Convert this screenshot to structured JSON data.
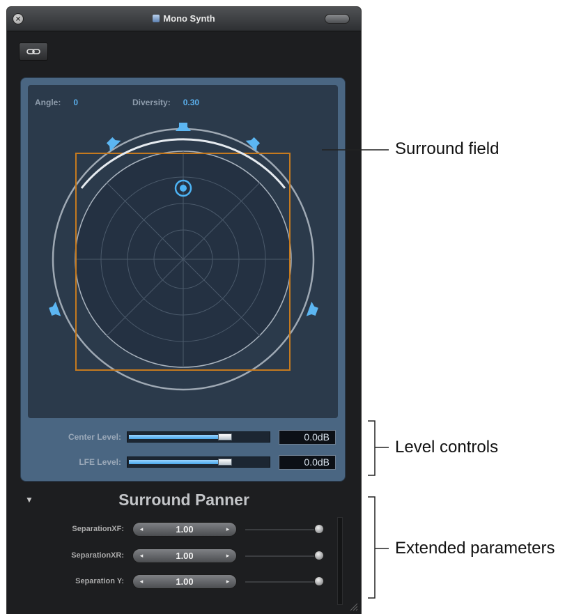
{
  "window": {
    "title": "Mono Synth",
    "close_symbol": "×"
  },
  "toolbar": {
    "link_icon": "link-icon"
  },
  "surround_field": {
    "angle_label": "Angle:",
    "angle_value": "0",
    "diversity_label": "Diversity:",
    "diversity_value": "0.30",
    "speaker_icon": "speaker-icon",
    "accent_color": "#4db4f5",
    "square_color": "#c57a1f"
  },
  "levels": {
    "center": {
      "label": "Center Level:",
      "value": "0.0dB",
      "fill_percent": 66
    },
    "lfe": {
      "label": "LFE Level:",
      "value": "0.0dB",
      "fill_percent": 66
    }
  },
  "extended": {
    "title": "Surround Panner",
    "disclosure_symbol": "▼",
    "params": [
      {
        "label": "SeparationXF:",
        "value": "1.00",
        "slider_percent": 100
      },
      {
        "label": "SeparationXR:",
        "value": "1.00",
        "slider_percent": 100
      },
      {
        "label": "Separation Y:",
        "value": "1.00",
        "slider_percent": 100
      }
    ]
  },
  "annotations": {
    "surround_field": "Surround field",
    "level_controls": "Level controls",
    "extended_parameters": "Extended parameters"
  }
}
